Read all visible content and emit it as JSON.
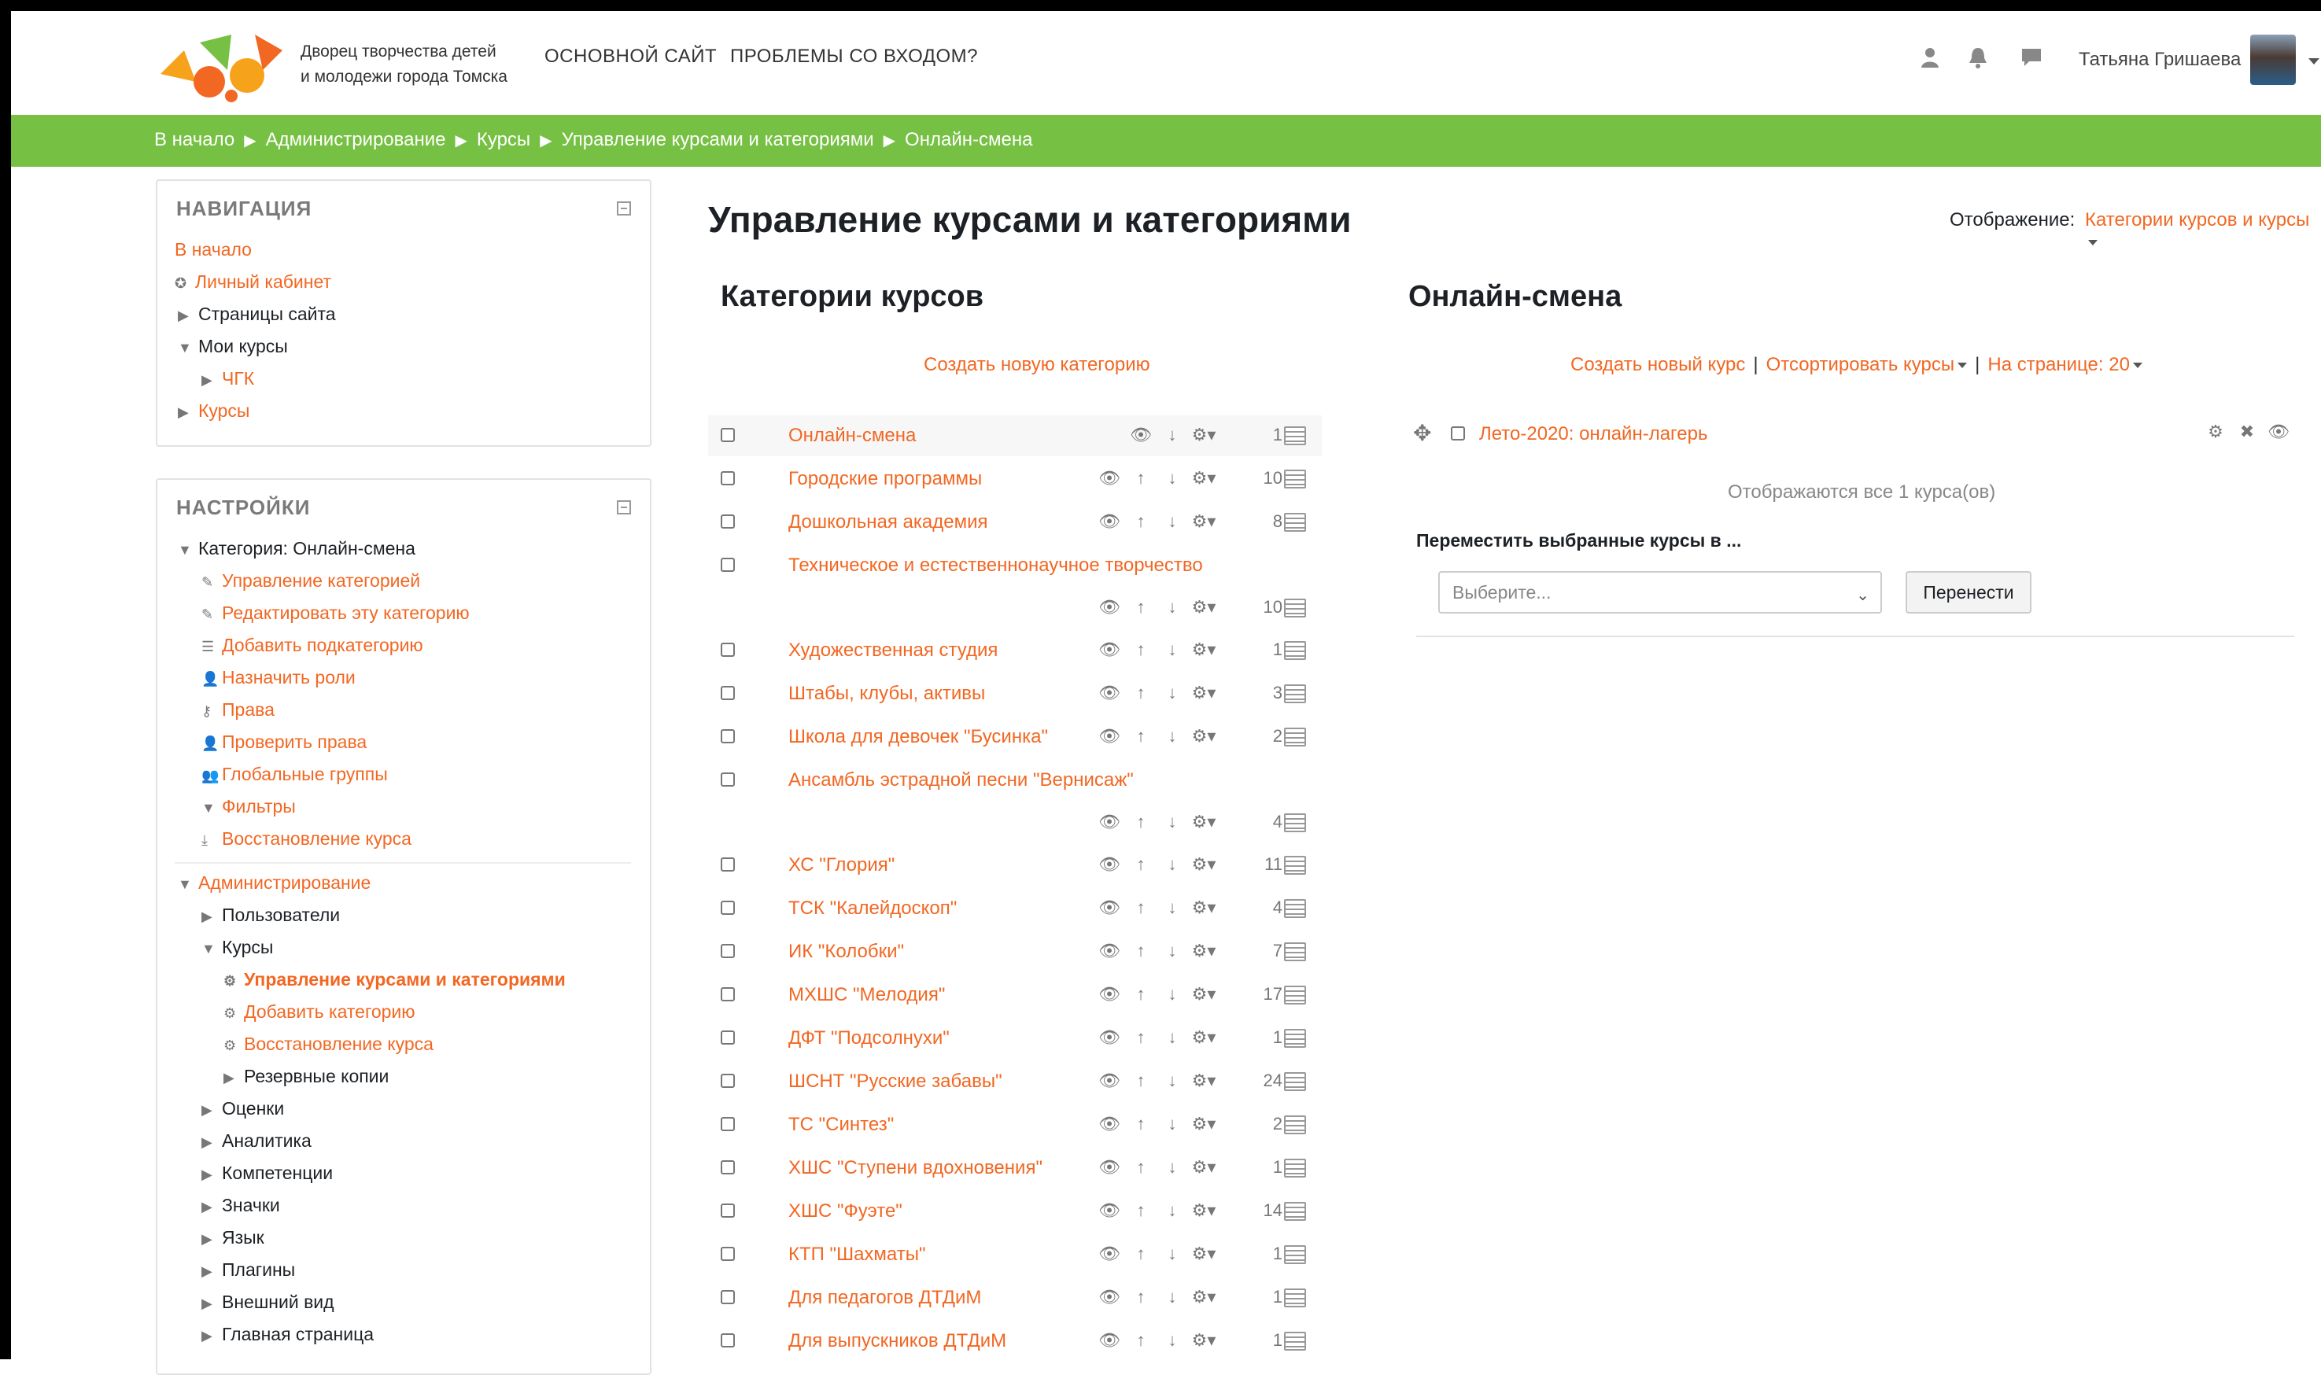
{
  "header": {
    "logo_text_line1": "Дворец творчества детей",
    "logo_text_line2": "и молодежи города Томска",
    "nav": [
      "ОСНОВНОЙ САЙТ",
      "ПРОБЛЕМЫ СО ВХОДОМ?"
    ],
    "user_name": "Татьяна Гришаева"
  },
  "breadcrumb": [
    "В начало",
    "Администрирование",
    "Курсы",
    "Управление курсами и категориями",
    "Онлайн-смена"
  ],
  "breadcrumb_sep": "▶",
  "navigation": {
    "title": "НАВИГАЦИЯ",
    "items": [
      "В начало",
      "Личный кабинет",
      "Страницы сайта",
      "Мои курсы",
      "ЧГК",
      "Курсы"
    ]
  },
  "settings": {
    "title": "НАСТРОЙКИ",
    "category": "Категория: Онлайн-смена",
    "category_items": [
      "Управление категорией",
      "Редактировать эту категорию",
      "Добавить подкатегорию",
      "Назначить роли",
      "Права",
      "Проверить права",
      "Глобальные группы",
      "Фильтры",
      "Восстановление курса"
    ],
    "admin": "Администрирование",
    "admin_items": [
      "Пользователи",
      "Курсы"
    ],
    "courses_items": [
      "Управление курсами и категориями",
      "Добавить категорию",
      "Восстановление курса",
      "Резервные копии"
    ],
    "admin_more": [
      "Оценки",
      "Аналитика",
      "Компетенции",
      "Значки",
      "Язык",
      "Плагины",
      "Внешний вид",
      "Главная страница"
    ]
  },
  "main": {
    "title": "Управление курсами и категориями",
    "view_label": "Отображение:",
    "view_value": "Категории курсов и курсы",
    "categories_title": "Категории курсов",
    "create_category": "Создать новую категорию",
    "categories": [
      {
        "name": "Онлайн-смена",
        "count": "1"
      },
      {
        "name": "Городские программы",
        "count": "10"
      },
      {
        "name": "Дошкольная академия",
        "count": "8"
      },
      {
        "name": "Техническое и естественнонаучное творчество",
        "count": "10"
      },
      {
        "name": "Художественная студия",
        "count": "1"
      },
      {
        "name": "Штабы, клубы, активы",
        "count": "3"
      },
      {
        "name": "Школа для девочек \"Бусинка\"",
        "count": "2"
      },
      {
        "name": "Ансамбль эстрадной песни \"Вернисаж\"",
        "count": "4"
      },
      {
        "name": "ХС \"Глория\"",
        "count": "11"
      },
      {
        "name": "ТСК \"Калейдоскоп\"",
        "count": "4"
      },
      {
        "name": "ИК \"Колобки\"",
        "count": "7"
      },
      {
        "name": "МХШС \"Мелодия\"",
        "count": "17"
      },
      {
        "name": "ДФТ \"Подсолнухи\"",
        "count": "1"
      },
      {
        "name": "ШСНТ \"Русские забавы\"",
        "count": "24"
      },
      {
        "name": "ТС \"Синтез\"",
        "count": "2"
      },
      {
        "name": "ХШС \"Ступени вдохновения\"",
        "count": "1"
      },
      {
        "name": "ХШС \"Фуэте\"",
        "count": "14"
      },
      {
        "name": "КТП \"Шахматы\"",
        "count": "1"
      },
      {
        "name": "Для педагогов ДТДиМ",
        "count": "1"
      },
      {
        "name": "Для выпускников ДТДиМ",
        "count": "1"
      }
    ],
    "right_title": "Онлайн-смена",
    "create_course": "Создать новый курс",
    "sort_courses": "Отсортировать курсы",
    "per_page": "На странице: 20",
    "sep": "|",
    "course": "Лето-2020: онлайн-лагерь",
    "shown_all": "Отображаются все 1 курса(ов)",
    "move_label": "Переместить выбранные курсы в ...",
    "select_placeholder": "Выберите...",
    "move_button": "Перенести"
  }
}
